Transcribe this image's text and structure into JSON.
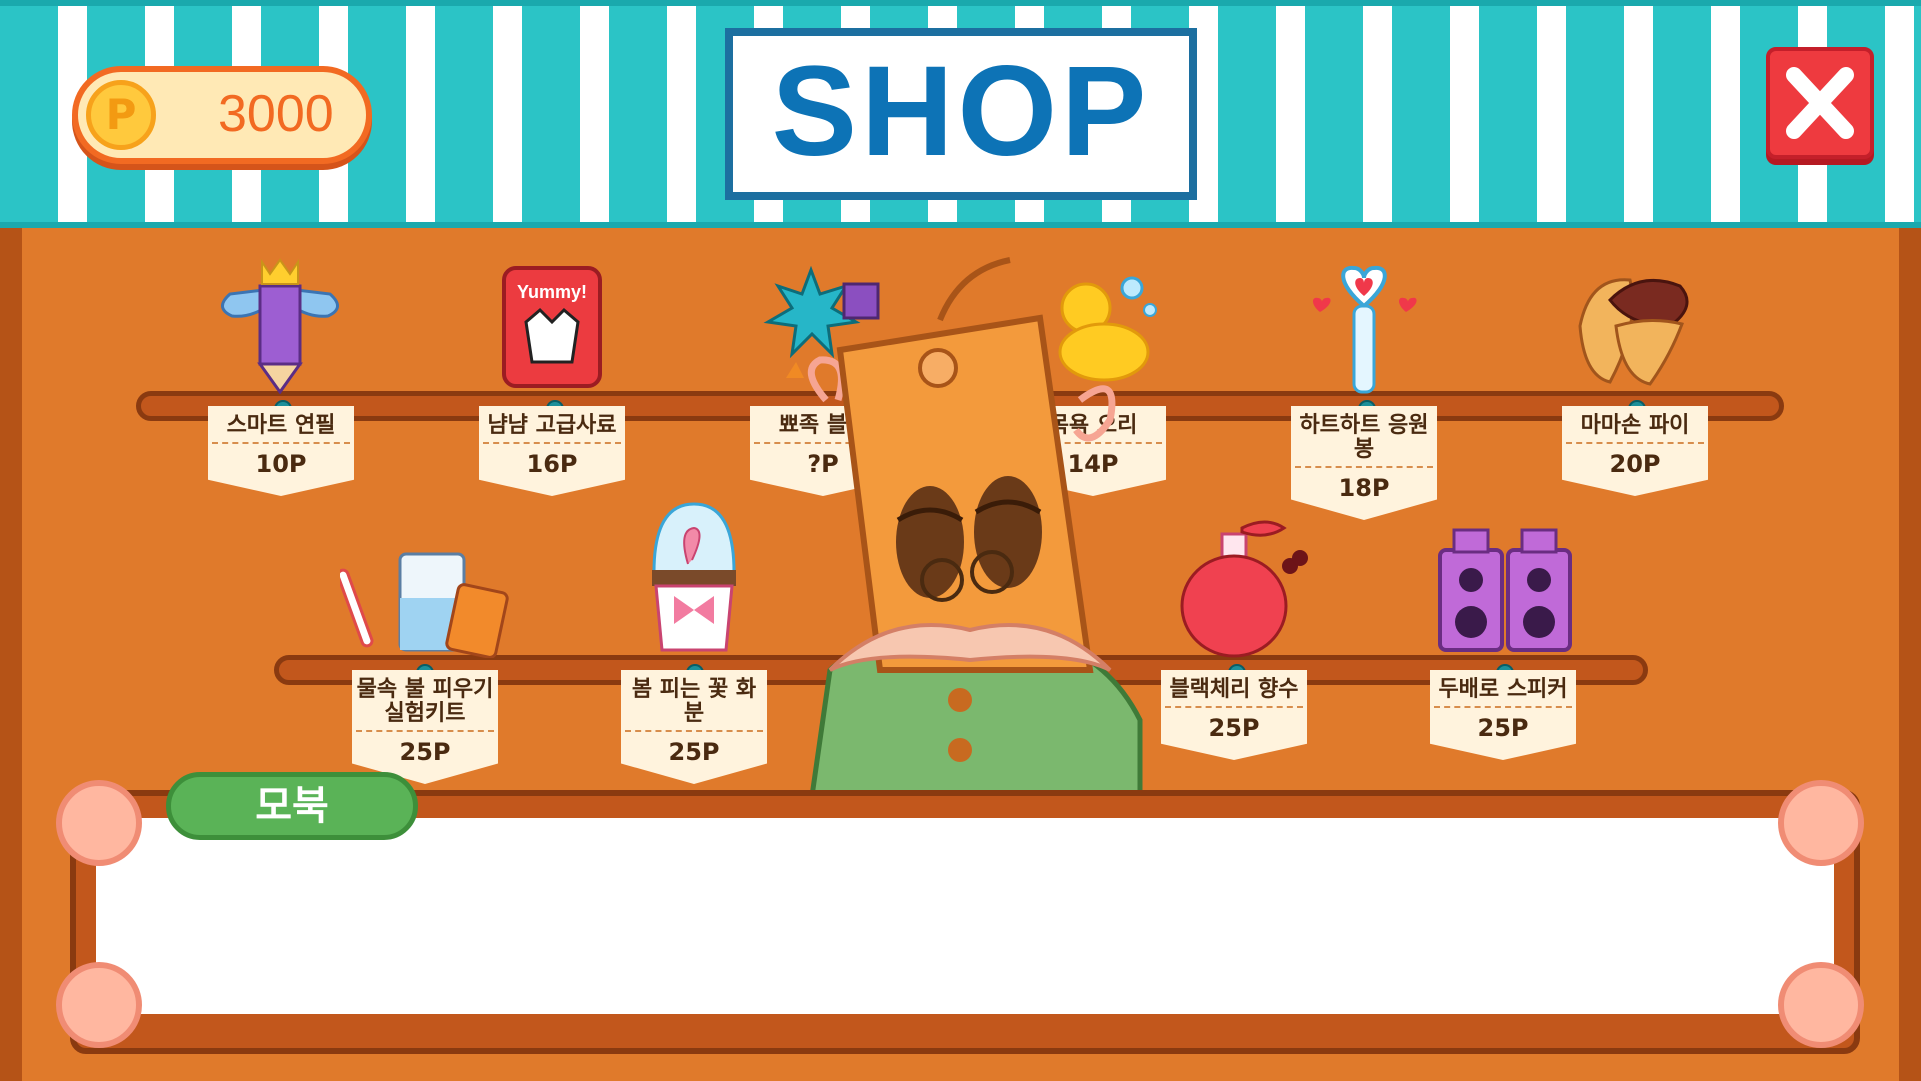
{
  "header": {
    "points": "3000",
    "coin_symbol": "P",
    "title": "SHOP"
  },
  "shelf_top": [
    {
      "name": "스마트 연필",
      "price": "10P",
      "icon": "winged-pencil-icon"
    },
    {
      "name": "냠냠 고급사료",
      "price": "16P",
      "icon": "dog-food-bag-icon"
    },
    {
      "name": "뾰족 블록",
      "price": "?P",
      "icon": "spiky-block-icon"
    },
    {
      "name": "목욕 오리",
      "price": "14P",
      "icon": "rubber-duck-icon"
    },
    {
      "name": "하트하트 응원봉",
      "price": "18P",
      "icon": "heart-lightstick-icon"
    },
    {
      "name": "마마손 파이",
      "price": "20P",
      "icon": "pie-icon"
    }
  ],
  "shelf_bottom": [
    {
      "name": "물속 불 피우기 실험키트",
      "price": "25P",
      "icon": "science-kit-icon"
    },
    {
      "name": "봄 피는 꽃 화분",
      "price": "25P",
      "icon": "flower-pot-icon"
    },
    {
      "name": "블랙체리 향수",
      "price": "25P",
      "icon": "perfume-bottle-icon"
    },
    {
      "name": "두배로 스피커",
      "price": "25P",
      "icon": "speaker-icon"
    }
  ],
  "dialogue": {
    "speaker": "모북",
    "text": ""
  },
  "colors": {
    "awning_teal": "#2bc4c6",
    "wood": "#e07a2b",
    "title_blue": "#0d73b6",
    "close_red": "#ee3a3f",
    "name_green": "#5ab357"
  }
}
